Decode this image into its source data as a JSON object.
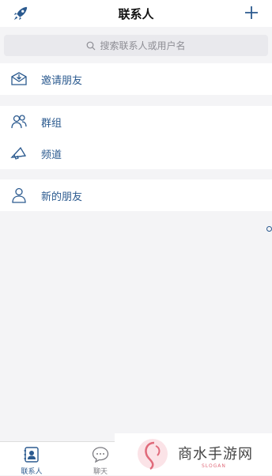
{
  "header": {
    "title": "联系人",
    "left_icon": "rocket-icon",
    "right_icon": "plus-icon"
  },
  "search": {
    "placeholder": "搜索联系人或用户名",
    "icon": "search-icon"
  },
  "sections": [
    {
      "items": [
        {
          "label": "邀请朋友",
          "icon": "invite-icon"
        }
      ]
    },
    {
      "items": [
        {
          "label": "群组",
          "icon": "group-icon"
        },
        {
          "label": "频道",
          "icon": "channel-icon"
        }
      ]
    },
    {
      "items": [
        {
          "label": "新的朋友",
          "icon": "new-friend-icon"
        }
      ]
    }
  ],
  "tabbar": {
    "tabs": [
      {
        "label": "联系人",
        "icon": "contacts-icon",
        "active": true
      },
      {
        "label": "聊天",
        "icon": "chat-icon",
        "active": false
      }
    ]
  },
  "watermark": {
    "text": "商水手游网",
    "sub": "SLOGAN"
  },
  "colors": {
    "accent": "#2b5a8f",
    "background": "#f4f4f6",
    "watermark_pink": "#e06a7a"
  }
}
